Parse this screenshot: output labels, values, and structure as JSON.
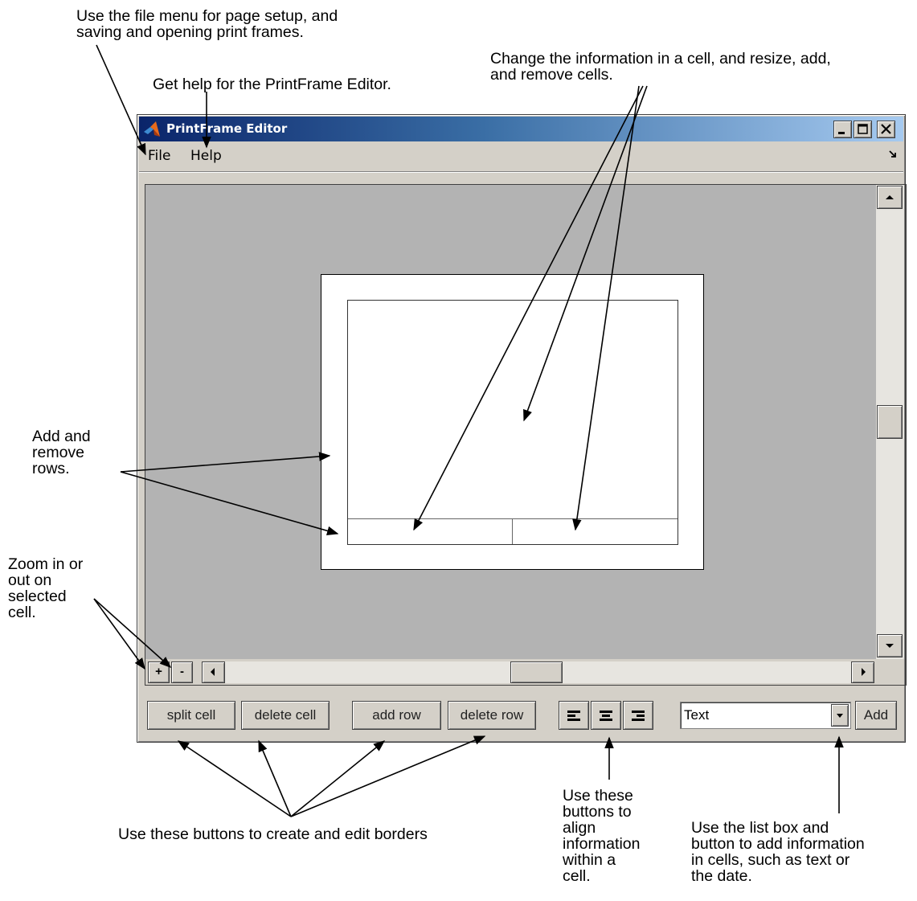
{
  "annotations": {
    "file_menu": [
      "Use the file menu for page setup, and",
      "saving and opening print frames."
    ],
    "help_menu": [
      "Get help for the PrintFrame Editor."
    ],
    "cells": [
      "Change the information in a cell, and resize, add,",
      "and remove cells."
    ],
    "rows": [
      "Add and",
      "remove",
      "rows."
    ],
    "zoom": [
      "Zoom in or",
      "out on",
      "selected",
      "cell."
    ],
    "border_buttons": [
      "Use these buttons to create and edit borders"
    ],
    "align_buttons": [
      "Use these",
      "buttons to",
      "align",
      "information",
      "within a",
      "cell."
    ],
    "list_box": [
      "Use the list box and",
      "button to add information",
      "in cells, such as text or",
      "the date."
    ]
  },
  "window": {
    "title": "PrintFrame Editor",
    "controls": [
      "minimize-icon",
      "maximize-icon",
      "close-icon"
    ]
  },
  "menu": {
    "file": "File",
    "help": "Help"
  },
  "zoom": {
    "in_label": "+",
    "out_label": "-"
  },
  "toolbar": {
    "split_cell": "split cell",
    "delete_cell": "delete cell",
    "add_row": "add row",
    "delete_row": "delete row",
    "align_icons": [
      "align-left-icon",
      "align-center-icon",
      "align-right-icon"
    ],
    "content_type": "Text",
    "add": "Add"
  }
}
